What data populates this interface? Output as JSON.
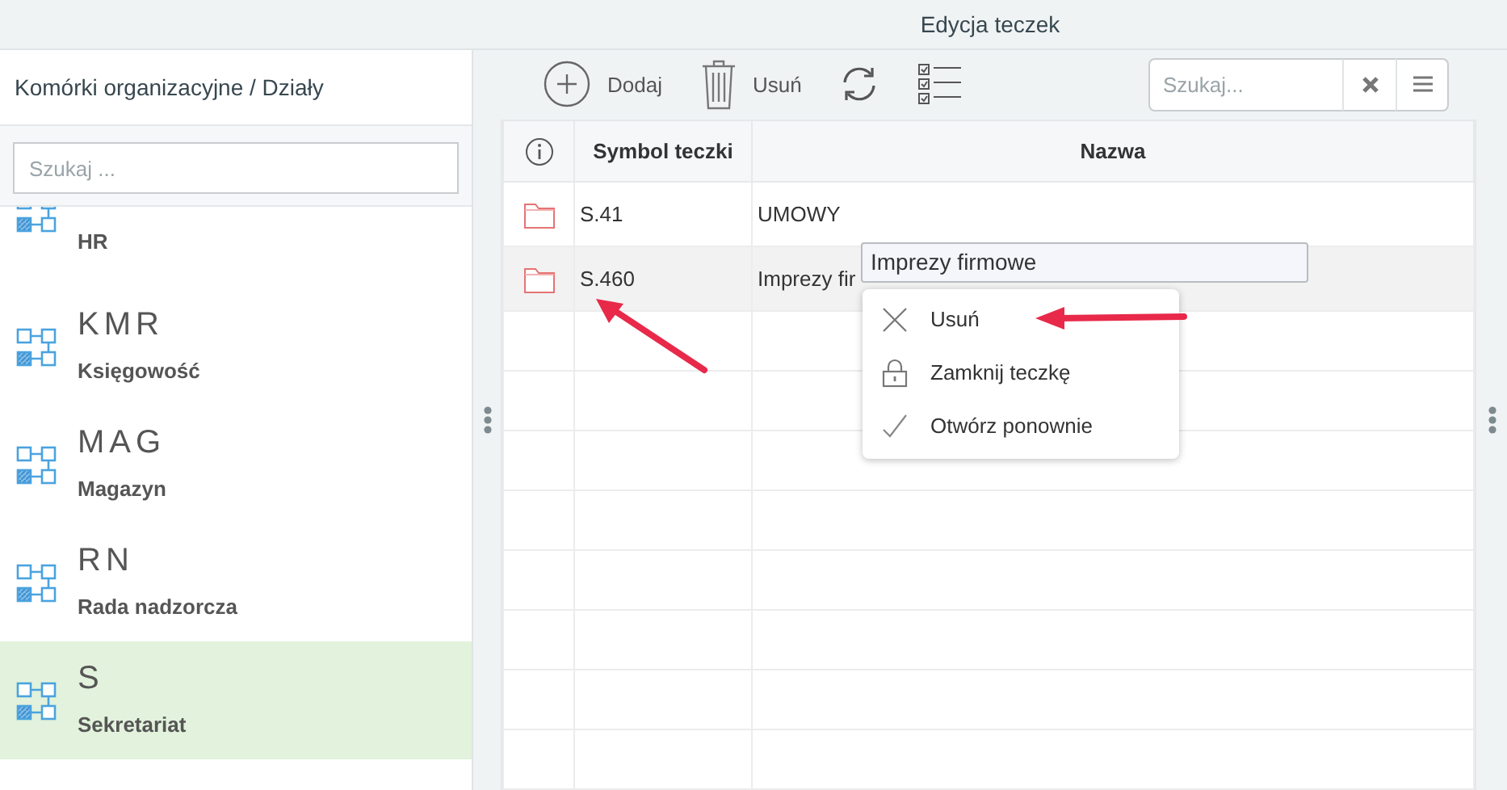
{
  "window": {
    "title": "Edycja teczek"
  },
  "sidebar": {
    "title": "Komórki organizacyjne / Działy",
    "search": {
      "placeholder": "Szukaj ..."
    },
    "items": [
      {
        "name": "HR",
        "selected": false
      },
      {
        "code": "KMR",
        "name": "Księgowość",
        "selected": false
      },
      {
        "code": "MAG",
        "name": "Magazyn",
        "selected": false
      },
      {
        "code": "RN",
        "name": "Rada nadzorcza",
        "selected": false
      },
      {
        "code": "S",
        "name": "Sekretariat",
        "selected": true
      }
    ]
  },
  "toolbar": {
    "buttons": [
      {
        "kind": "add",
        "label": "Dodaj"
      },
      {
        "kind": "delete",
        "label": "Usuń"
      },
      {
        "kind": "refresh"
      },
      {
        "kind": "checklist"
      }
    ],
    "search": {
      "placeholder": "Szukaj..."
    }
  },
  "table": {
    "columns": [
      {
        "kind": "icon"
      },
      {
        "kind": "text",
        "label": "Symbol teczki"
      },
      {
        "kind": "text",
        "label": "Nazwa"
      }
    ],
    "rows": [
      {
        "symbol": "S.41",
        "name": "UMOWY",
        "selected": false
      },
      {
        "symbol": "S.460",
        "name": "Imprezy fir",
        "selected": true
      }
    ]
  },
  "tooltip": {
    "text": "Imprezy firmowe"
  },
  "context_menu": {
    "items": [
      {
        "kind": "delete",
        "label": "Usuń"
      },
      {
        "kind": "lock",
        "label": "Zamknij teczkę"
      },
      {
        "kind": "check",
        "label": "Otwórz ponownie"
      }
    ]
  }
}
